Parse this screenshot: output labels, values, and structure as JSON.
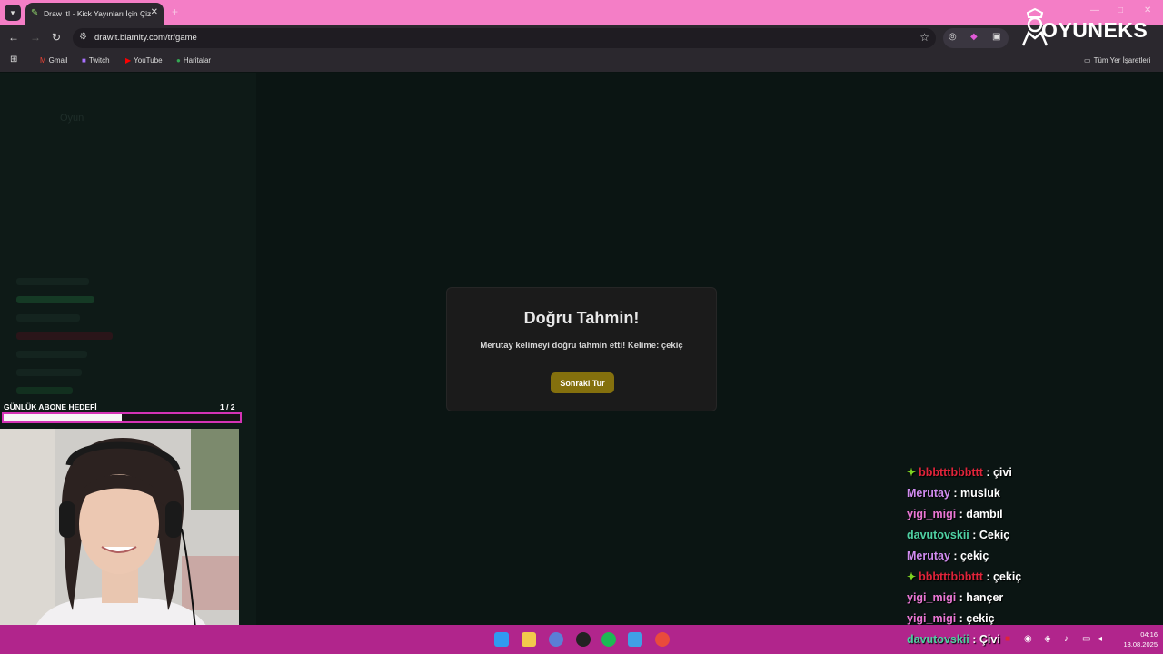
{
  "browser": {
    "tab_title": "Draw It! - Kick Yayınları İçin Çiz",
    "url": "drawit.blamity.com/tr/game",
    "bookmarks": [
      "Gmail",
      "Twitch",
      "YouTube",
      "Haritalar"
    ],
    "all_bookmarks": "Tüm Yer İşaretleri"
  },
  "overlay_logo": "OYUNEKS",
  "modal": {
    "title": "Doğru Tahmin!",
    "message": "Merutay kelimeyi doğru tahmin etti! Kelime: çekiç",
    "button": "Sonraki Tur"
  },
  "sub_goal": {
    "label": "GÜNLÜK ABONE HEDEFİ",
    "count": "1  / 2",
    "progress": 0.5
  },
  "chat": {
    "messages": [
      {
        "user": "bbbtttbbbttt",
        "text": ": çivi",
        "color": "#e0243a",
        "badge": true
      },
      {
        "user": "Merutay",
        "text": ": musluk",
        "color": "#d18cf0",
        "badge": false
      },
      {
        "user": "yigi_migi",
        "text": ": dambıl",
        "color": "#ea77d4",
        "badge": false
      },
      {
        "user": "davutovskii",
        "text": ": Cekiç",
        "color": "#4fd1a3",
        "badge": false
      },
      {
        "user": "Merutay",
        "text": ": çekiç",
        "color": "#d18cf0",
        "badge": false
      },
      {
        "user": "bbbtttbbbttt",
        "text": ": çekiç",
        "color": "#e0243a",
        "badge": true
      },
      {
        "user": "yigi_migi",
        "text": ": hançer",
        "color": "#ea77d4",
        "badge": false
      },
      {
        "user": "yigi_migi",
        "text": ": çekiç",
        "color": "#ea77d4",
        "badge": false
      },
      {
        "user": "davutovskii",
        "text": ": Çivi",
        "color": "#4fd1a3",
        "badge": false
      }
    ]
  },
  "taskbar": {
    "time": "04:16",
    "date": "13.08.2025"
  },
  "colors": {
    "tabbar": "#f47ec6",
    "taskbar": "#b1258c",
    "button": "#84700d",
    "goal_border": "#d433b6"
  }
}
